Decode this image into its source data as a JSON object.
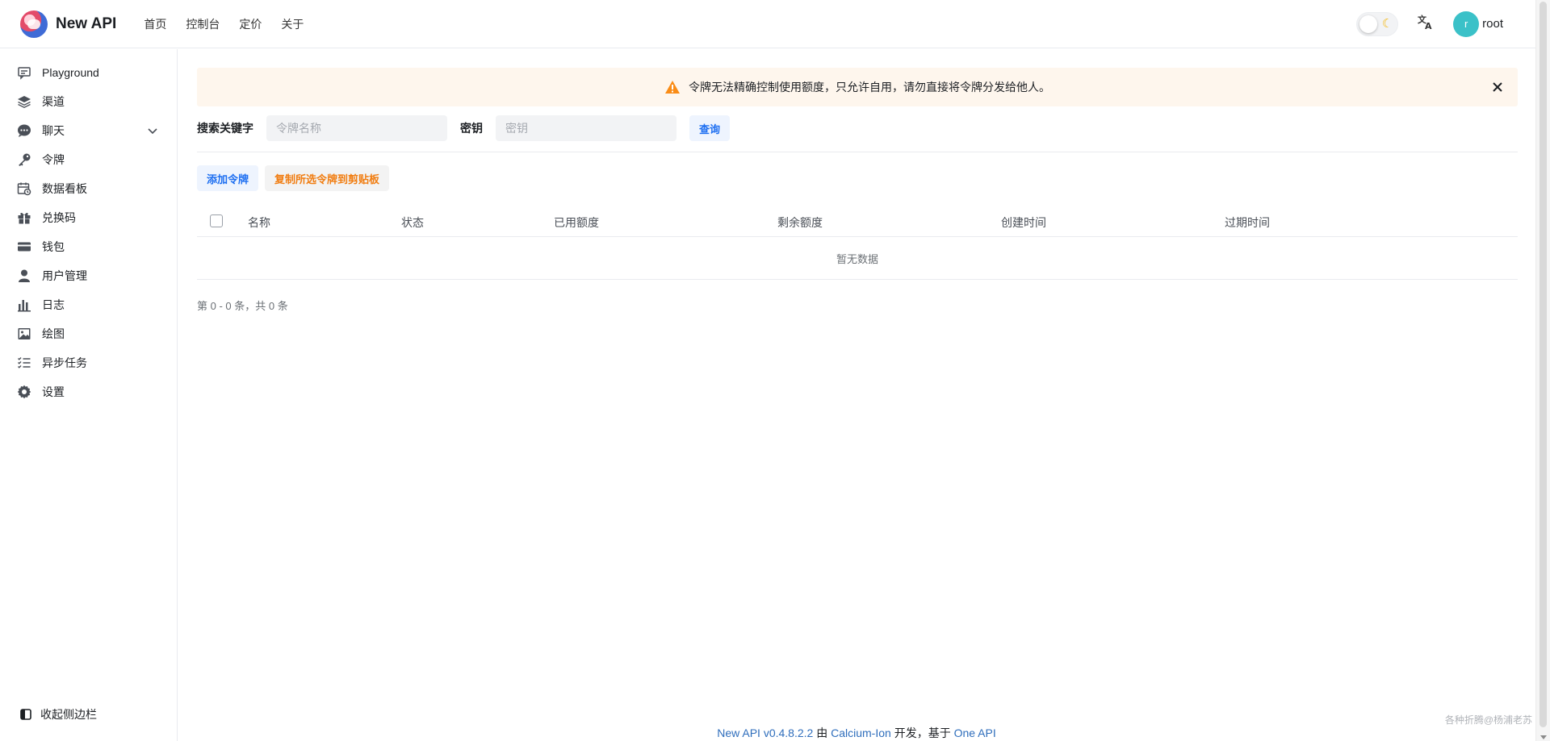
{
  "header": {
    "brand": "New API",
    "nav": [
      "首页",
      "控制台",
      "定价",
      "关于"
    ],
    "theme_icon": "moon-icon",
    "translate_icon": "translate-icon",
    "avatar_letter": "r",
    "username": "root"
  },
  "sidebar": {
    "items": [
      {
        "label": "Playground",
        "icon": "message-square-icon"
      },
      {
        "label": "渠道",
        "icon": "layers-icon"
      },
      {
        "label": "聊天",
        "icon": "chat-bubble-icon"
      },
      {
        "label": "令牌",
        "icon": "key-icon"
      },
      {
        "label": "数据看板",
        "icon": "calendar-clock-icon"
      },
      {
        "label": "兑换码",
        "icon": "gift-icon"
      },
      {
        "label": "钱包",
        "icon": "credit-card-icon"
      },
      {
        "label": "用户管理",
        "icon": "user-icon"
      },
      {
        "label": "日志",
        "icon": "bar-chart-icon"
      },
      {
        "label": "绘图",
        "icon": "image-icon"
      },
      {
        "label": "异步任务",
        "icon": "checklist-icon"
      },
      {
        "label": "设置",
        "icon": "gear-icon"
      }
    ],
    "collapse_label": "收起侧边栏"
  },
  "banner": {
    "text": "令牌无法精确控制使用额度，只允许自用，请勿直接将令牌分发给他人。",
    "accent": "#fa8c16"
  },
  "search": {
    "keyword_label": "搜索关键字",
    "keyword_placeholder": "令牌名称",
    "key_label": "密钥",
    "key_placeholder": "密钥",
    "query_label": "查询"
  },
  "actions": {
    "add_label": "添加令牌",
    "copy_label": "复制所选令牌到剪贴板"
  },
  "table": {
    "columns": [
      "名称",
      "状态",
      "已用额度",
      "剩余额度",
      "创建时间",
      "过期时间"
    ],
    "empty_text": "暂无数据"
  },
  "pagination": {
    "text": "第 0 - 0 条，共 0 条"
  },
  "footer": {
    "app_version": "New API v0.4.8.2.2",
    "by": "由",
    "author": "Calcium-Ion",
    "developed": "开发，基于",
    "base": "One API"
  },
  "watermark": "各种折腾@杨浦老苏",
  "colors": {
    "primary": "#1e6ff1",
    "warning_text": "#f17d11",
    "banner_bg": "#fef6ed",
    "link": "#2f6ebc"
  }
}
